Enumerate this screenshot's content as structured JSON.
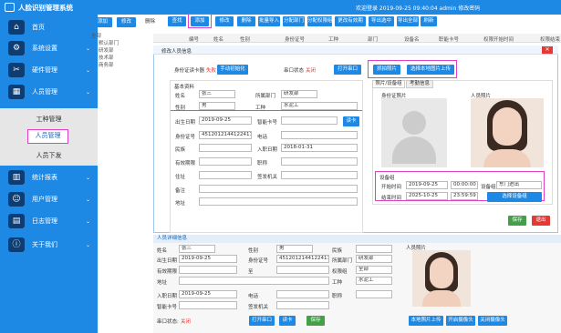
{
  "app": {
    "title": "人脸识别管理系统",
    "top_right": "欢迎登录 2019-09-25 09:40:04 admin 修改密码"
  },
  "sidebar": {
    "items": [
      {
        "label": "首页",
        "icon": "home-icon",
        "glyph": "⌂"
      },
      {
        "label": "系统设置",
        "icon": "gear-icon",
        "glyph": "⚙"
      },
      {
        "label": "硬件管理",
        "icon": "wrench-icon",
        "glyph": "✂"
      },
      {
        "label": "人员管理",
        "icon": "calendar-icon",
        "glyph": "▦"
      },
      {
        "label": "统计报表",
        "icon": "chart-icon",
        "glyph": "▥"
      },
      {
        "label": "用户管理",
        "icon": "user-icon",
        "glyph": "☺"
      },
      {
        "label": "日志管理",
        "icon": "log-icon",
        "glyph": "▤"
      },
      {
        "label": "关于我们",
        "icon": "info-icon",
        "glyph": "ⓘ"
      }
    ],
    "sub": [
      "工种管理",
      "人员管理",
      "人员下发"
    ]
  },
  "tree": {
    "root": "全部",
    "children": [
      "默认部门",
      "研发部",
      "技术部",
      "商务部"
    ]
  },
  "left_toolbar": [
    "添加",
    "修改",
    "删除"
  ],
  "toolbar": [
    "查找",
    "添加",
    "修改",
    "删除",
    "批量导入",
    "分配部门",
    "分配权限组",
    "更改有效期",
    "导出选中",
    "导出全部",
    "刷新"
  ],
  "table_headers": [
    "编号",
    "姓名",
    "性别",
    "身份证号",
    "工种",
    "部门",
    "设备名",
    "职能卡号",
    "权限开始时间",
    "权限结束"
  ],
  "modal": {
    "title": "修改人员信息",
    "reader_label": "身份证读卡器",
    "reader_status": "失败",
    "manual_init": "手动初始化",
    "port_label": "串口状态",
    "port_status": "关闭",
    "open_port": "打开串口",
    "capture": "抓拍照片",
    "upload": "选择本地图片上传",
    "basic_legend": "基本资料",
    "name_label": "姓名",
    "name": "张三",
    "dept_label": "所属部门",
    "dept": "研发部",
    "gender_label": "性别",
    "gender": "男",
    "job_label": "工种",
    "job": "水泥工",
    "birth_label": "出生日期",
    "birth": "2019-09-25",
    "card_label": "智能卡号",
    "read_card": "读卡",
    "id_label": "身份证号",
    "id": "451201214412241141",
    "phone_label": "电话",
    "nation_label": "民族",
    "entry_label": "入职日期",
    "entry": "2018-01-31",
    "valid_label": "有效期限",
    "title_label": "职称",
    "address_label": "住址",
    "issuer_label": "签发机关",
    "remark_label": "备注",
    "addr2_label": "地址",
    "tab1": "照片/设备组",
    "tab2": "考勤信息",
    "id_photo": "身份证照片",
    "person_photo": "人员照片",
    "device_legend": "设备组",
    "start_label": "开始时间",
    "start_date": "2019-09-25",
    "start_time": "00:00:00",
    "end_label": "结束时间",
    "end_date": "2025-10-25",
    "end_time": "23:59:59",
    "group_label": "设备组",
    "group": "东门进出",
    "select_group": "选择设备组",
    "save": "保存",
    "exit": "退出"
  },
  "detail": {
    "title": "人员详细信息",
    "name_label": "姓名",
    "name": "张三",
    "gender_label": "性别",
    "gender": "男",
    "nation_label": "民族",
    "birth_label": "出生日期",
    "birth": "2019-09-25",
    "id_label": "身份证号",
    "id": "451201214412241141",
    "dept_label": "所属部门",
    "dept": "研发部",
    "valid_label": "有效期限",
    "to": "至",
    "perm_label": "权限组",
    "perm": "全部",
    "addr_label": "地址",
    "job_label": "工种",
    "job": "水泥工",
    "entry_label": "入职日期",
    "entry": "2019-09-25",
    "phone_label": "电话",
    "title_label": "职称",
    "card_label": "智能卡号",
    "issuer_label": "签发机关",
    "port_label": "串口状态:",
    "port_status": "关闭",
    "open_port": "打开串口",
    "read_card": "读卡",
    "save": "保存",
    "photo_label": "人员照片",
    "upload": "本地照片上传",
    "cam1": "开启摄像头",
    "cam2": "关闭摄像头"
  }
}
